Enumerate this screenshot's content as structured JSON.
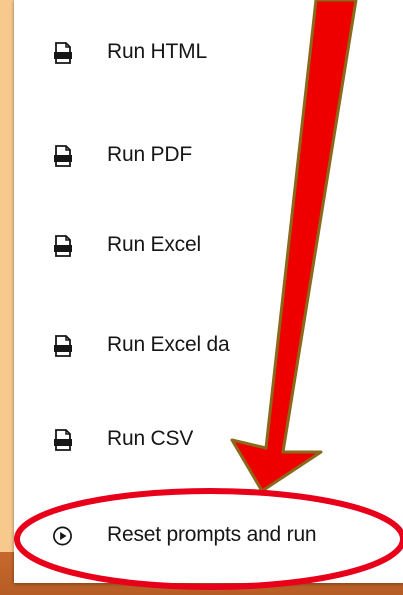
{
  "menu": {
    "items": [
      {
        "label": "Run HTML",
        "icon": "html-file-icon"
      },
      {
        "label": "Run PDF",
        "icon": "pdf-file-icon"
      },
      {
        "label": "Run Excel",
        "icon": "excel-file-icon"
      },
      {
        "label": "Run Excel da",
        "icon": "excel-data-file-icon"
      },
      {
        "label": "Run CSV",
        "icon": "csv-file-icon"
      },
      {
        "label": "Reset prompts and run",
        "icon": "play-circle-icon"
      }
    ]
  },
  "annotation": {
    "arrow_color": "#ee0000",
    "arrow_outline_color": "#8a6a1a",
    "ellipse_color": "#e8001a"
  }
}
